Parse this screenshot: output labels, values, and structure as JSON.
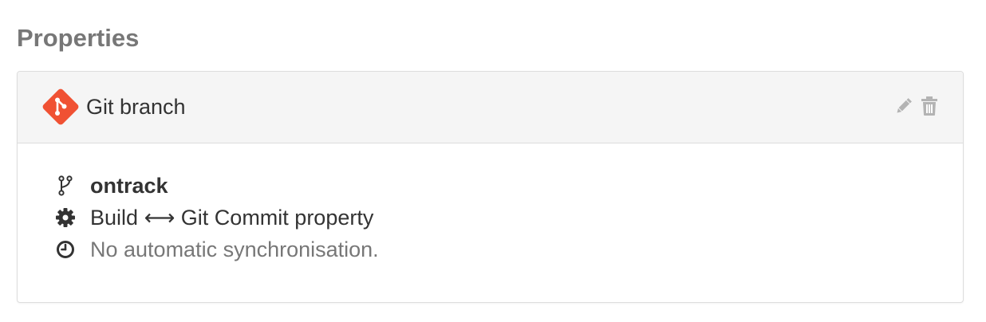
{
  "section": {
    "title": "Properties"
  },
  "property_panel": {
    "title": "Git branch",
    "logo_icon": "git-logo-icon",
    "logo_color": "#f05133",
    "actions": [
      {
        "icon": "pencil-icon",
        "label": "Edit"
      },
      {
        "icon": "trash-icon",
        "label": "Delete"
      }
    ],
    "details": {
      "branch": {
        "icon": "code-fork-icon",
        "text": "ontrack"
      },
      "link": {
        "icon": "gear-icon",
        "prefix": "Build",
        "arrow": "⟷",
        "suffix": "Git Commit property"
      },
      "sync": {
        "icon": "clock-icon",
        "text": "No automatic synchronisation."
      }
    }
  },
  "colors": {
    "heading_background": "#f5f5f5",
    "border": "#dddddd",
    "muted_text": "#777777",
    "icon_gray": "#b3b3b3"
  }
}
